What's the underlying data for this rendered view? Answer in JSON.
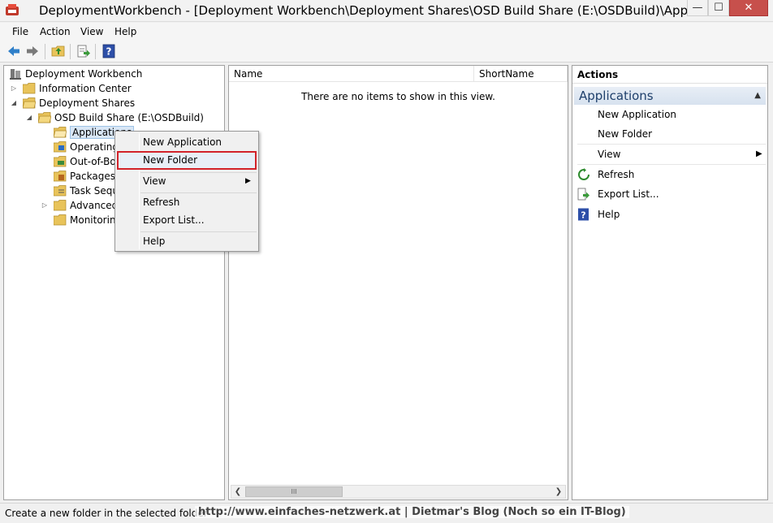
{
  "window": {
    "title": "DeploymentWorkbench - [Deployment Workbench\\Deployment Shares\\OSD Build Share (E:\\OSDBuild)\\Applications]",
    "minimize_label": "—",
    "maximize_label": "☐",
    "close_label": "✕"
  },
  "menu": [
    "File",
    "Action",
    "View",
    "Help"
  ],
  "toolbar": {
    "icons": [
      "back-arrow-icon",
      "forward-arrow-icon",
      "up-folder-icon",
      "export-list-icon",
      "help-icon"
    ]
  },
  "tree": {
    "items": [
      {
        "label": "Deployment Workbench",
        "expander": ""
      },
      {
        "label": "Information Center",
        "expander": "▷"
      },
      {
        "label": "Deployment Shares",
        "expander": "◢"
      },
      {
        "label": "OSD Build Share (E:\\OSDBuild)",
        "expander": "◢"
      },
      {
        "label": "Applications",
        "expander": ""
      },
      {
        "label": "Operating Systems",
        "expander": ""
      },
      {
        "label": "Out-of-Box Drivers",
        "expander": ""
      },
      {
        "label": "Packages",
        "expander": ""
      },
      {
        "label": "Task Sequences",
        "expander": ""
      },
      {
        "label": "Advanced Configuration",
        "expander": "▷"
      },
      {
        "label": "Monitoring",
        "expander": ""
      }
    ]
  },
  "list": {
    "columns": [
      "Name",
      "ShortName"
    ],
    "empty_message": "There are no items to show in this view.",
    "scroll_thumb": "III"
  },
  "actions": {
    "header": "Actions",
    "group": "Applications",
    "items": [
      "New Application",
      "New Folder",
      "View",
      "Refresh",
      "Export List...",
      "Help"
    ]
  },
  "context_menu": {
    "items": [
      "New Application",
      "New Folder",
      "View",
      "Refresh",
      "Export List...",
      "Help"
    ],
    "highlighted": "New Folder"
  },
  "status": {
    "text": "Create a new folder in the selected folder",
    "watermark": "http://www.einfaches-netzwerk.at | Dietmar's Blog (Noch so ein IT-Blog)"
  },
  "colors": {
    "highlight_border": "#d2232a",
    "group_text": "#1e3f6b",
    "close_button": "#c7504c"
  }
}
